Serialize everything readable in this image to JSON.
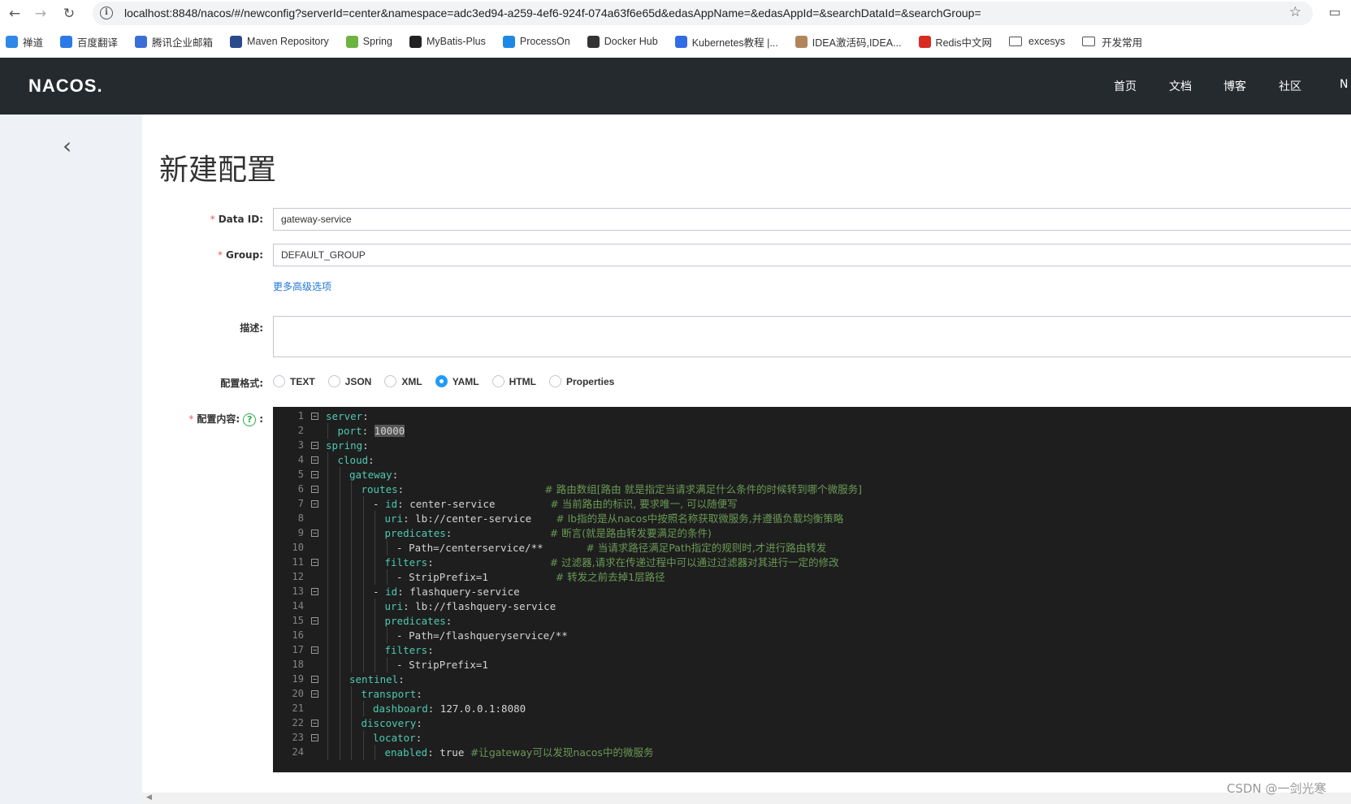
{
  "browser": {
    "url": "localhost:8848/nacos/#/newconfig?serverId=center&namespace=adc3ed94-a259-4ef6-924f-074a63f6e65d&edasAppName=&edasAppId=&searchDataId=&searchGroup=",
    "bookmarks": [
      {
        "label": "禅道",
        "color": "#2f87e8"
      },
      {
        "label": "百度翻译",
        "color": "#2c7ae8"
      },
      {
        "label": "腾讯企业邮箱",
        "color": "#3a6fd8"
      },
      {
        "label": "Maven Repository",
        "color": "#2a4a8a"
      },
      {
        "label": "Spring",
        "color": "#6db33f"
      },
      {
        "label": "MyBatis-Plus",
        "color": "#222222"
      },
      {
        "label": "ProcessOn",
        "color": "#1e88e5"
      },
      {
        "label": "Docker Hub",
        "color": "#333333"
      },
      {
        "label": "Kubernetes教程 |...",
        "color": "#326ce5"
      },
      {
        "label": "IDEA激活码,IDEA...",
        "color": "#b0855a"
      },
      {
        "label": "Redis中文网",
        "color": "#d82c20"
      },
      {
        "label": "excesys",
        "folder": true
      },
      {
        "label": "开发常用",
        "folder": true
      }
    ]
  },
  "header": {
    "logo": "NACOS.",
    "nav": [
      "首页",
      "文档",
      "博客",
      "社区",
      "N"
    ]
  },
  "page": {
    "title": "新建配置",
    "data_id_label": "Data ID:",
    "data_id_value": "gateway-service",
    "group_label": "Group:",
    "group_value": "DEFAULT_GROUP",
    "more_options": "更多高级选项",
    "desc_label": "描述:",
    "format_label": "配置格式:",
    "formats": [
      "TEXT",
      "JSON",
      "XML",
      "YAML",
      "HTML",
      "Properties"
    ],
    "selected_format": "YAML",
    "content_label": "配置内容:",
    "help_icon": "?",
    "content_suffix": ":"
  },
  "editor": {
    "lines": [
      {
        "n": "1",
        "indent": 0,
        "fold": true,
        "key": "server",
        "val": "",
        "cmt": ""
      },
      {
        "n": "2",
        "indent": 1,
        "fold": false,
        "key": "port",
        "val": "10000",
        "num": true,
        "cmt": ""
      },
      {
        "n": "3",
        "indent": 0,
        "fold": true,
        "key": "spring",
        "val": "",
        "cmt": ""
      },
      {
        "n": "4",
        "indent": 1,
        "fold": true,
        "key": "cloud",
        "val": "",
        "cmt": ""
      },
      {
        "n": "5",
        "indent": 2,
        "fold": true,
        "key": "gateway",
        "val": "",
        "cmt": ""
      },
      {
        "n": "6",
        "indent": 3,
        "fold": true,
        "key": "routes",
        "val": "",
        "pad": "                       ",
        "cmt": "# 路由数组[路由 就是指定当请求满足什么条件的时候转到哪个微服务]"
      },
      {
        "n": "7",
        "indent": 4,
        "fold": true,
        "dash": true,
        "key": "id",
        "val": "center-service",
        "pad": "         ",
        "cmt": "# 当前路由的标识, 要求唯一, 可以随便写"
      },
      {
        "n": "8",
        "indent": 5,
        "fold": false,
        "key": "uri",
        "val": "lb://center-service",
        "pad": "    ",
        "cmt": "# lb指的是从nacos中按照名称获取微服务,并遵循负载均衡策略"
      },
      {
        "n": "9",
        "indent": 5,
        "fold": true,
        "key": "predicates",
        "val": "",
        "pad": "                ",
        "cmt": "# 断言(就是路由转发要满足的条件)"
      },
      {
        "n": "10",
        "indent": 6,
        "fold": false,
        "dash": true,
        "raw": "Path=/centerservice/**",
        "pad": "       ",
        "cmt": "# 当请求路径满足Path指定的规则时,才进行路由转发"
      },
      {
        "n": "11",
        "indent": 5,
        "fold": true,
        "key": "filters",
        "val": "",
        "pad": "                   ",
        "cmt": "# 过滤器,请求在传递过程中可以通过过滤器对其进行一定的修改"
      },
      {
        "n": "12",
        "indent": 6,
        "fold": false,
        "dash": true,
        "raw": "StripPrefix=1",
        "pad": "           ",
        "cmt": "# 转发之前去掉1层路径"
      },
      {
        "n": "13",
        "indent": 4,
        "fold": true,
        "dash": true,
        "key": "id",
        "val": "flashquery-service",
        "cmt": ""
      },
      {
        "n": "14",
        "indent": 5,
        "fold": false,
        "key": "uri",
        "val": "lb://flashquery-service",
        "cmt": ""
      },
      {
        "n": "15",
        "indent": 5,
        "fold": true,
        "key": "predicates",
        "val": "",
        "cmt": ""
      },
      {
        "n": "16",
        "indent": 6,
        "fold": false,
        "dash": true,
        "raw": "Path=/flashqueryservice/**",
        "cmt": ""
      },
      {
        "n": "17",
        "indent": 5,
        "fold": true,
        "key": "filters",
        "val": "",
        "cmt": ""
      },
      {
        "n": "18",
        "indent": 6,
        "fold": false,
        "dash": true,
        "raw": "StripPrefix=1",
        "cmt": ""
      },
      {
        "n": "19",
        "indent": 2,
        "fold": true,
        "key": "sentinel",
        "val": "",
        "cmt": ""
      },
      {
        "n": "20",
        "indent": 3,
        "fold": true,
        "key": "transport",
        "val": "",
        "cmt": ""
      },
      {
        "n": "21",
        "indent": 4,
        "fold": false,
        "key": "dashboard",
        "val": "127.0.0.1:8080",
        "cmt": ""
      },
      {
        "n": "22",
        "indent": 3,
        "fold": true,
        "key": "discovery",
        "val": "",
        "cmt": ""
      },
      {
        "n": "23",
        "indent": 4,
        "fold": true,
        "key": "locator",
        "val": "",
        "cmt": ""
      },
      {
        "n": "24",
        "indent": 5,
        "fold": false,
        "key": "enabled",
        "val": "true",
        "pad": " ",
        "cmt": "#让gateway可以发现nacos中的微服务"
      }
    ]
  },
  "watermark": "CSDN @一剑光寒"
}
